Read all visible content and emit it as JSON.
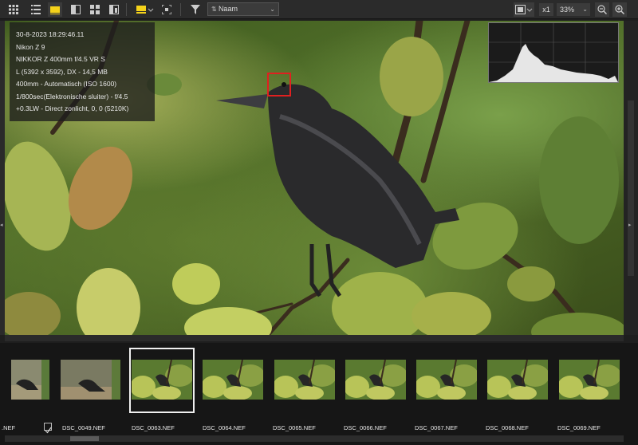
{
  "toolbar": {
    "sort_label": "Naam",
    "zoom_multiplier": "x1",
    "zoom_percent": "33%",
    "icons": [
      "grid-view-icon",
      "list-view-icon",
      "single-view-icon",
      "split-view-icon",
      "grid-2x2-icon",
      "compare-icon",
      "filter-icon",
      "fullscreen-icon",
      "zoom-out-icon",
      "zoom-in-icon"
    ]
  },
  "info": {
    "lines": [
      "30-8-2023 18:29:46.11",
      "Nikon Z 9",
      "NIKKOR Z 400mm f/4.5 VR S",
      "L (5392 x 3592), DX - 14,5 MB",
      "400mm - Automatisch (ISO 1600)",
      "1/800sec(Elektronische sluiter) - f/4.5",
      "+0.3LW - Direct zonlicht, 0, 0 (5210K)"
    ]
  },
  "filmstrip": {
    "first_partial_name": ".NEF",
    "items": [
      "DSC_0049.NEF",
      "DSC_0063.NEF",
      "DSC_0064.NEF",
      "DSC_0065.NEF",
      "DSC_0066.NEF",
      "DSC_0067.NEF",
      "DSC_0068.NEF",
      "DSC_0069.NEF"
    ],
    "selected_index": 1
  },
  "colors": {
    "accent": "#f5d21a",
    "focus_box": "#e02020"
  }
}
